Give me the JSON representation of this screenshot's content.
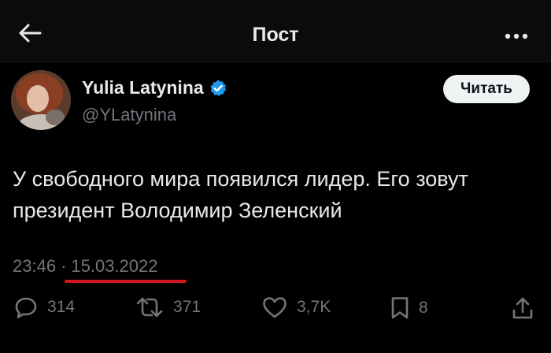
{
  "header": {
    "title": "Пост",
    "back_icon": "arrow-left-icon",
    "more_icon": "more-dots-icon"
  },
  "author": {
    "name": "Yulia Latynina",
    "handle": "@YLatynina",
    "verified_icon": "verified-badge-icon",
    "follow_label": "Читать"
  },
  "tweet": {
    "text": "У свободного мира появился лидер. Его зовут президент Володимир Зеленский",
    "time": "23:46",
    "separator": "·",
    "date": "15.03.2022"
  },
  "actions": {
    "replies": "314",
    "reposts": "371",
    "likes": "3,7K",
    "bookmarks": "8"
  },
  "colors": {
    "background": "#000000",
    "verified": "#1d9bf0",
    "underline": "#d0181c",
    "muted": "#71767b"
  }
}
